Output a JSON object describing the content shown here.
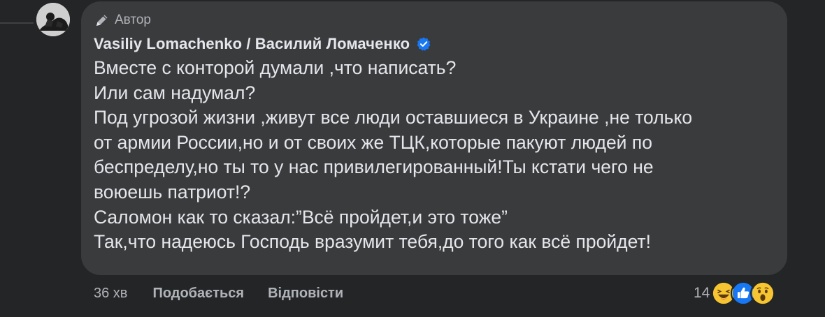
{
  "comment": {
    "author_badge": "Автор",
    "author_name": "Vasiliy Lomachenko / Василий Ломаченко",
    "lines": [
      "Вместе с конторой думали ,что написать?",
      "Или сам надумал?",
      "Под угрозой жизни ,живут все люди оставшиеся в Украине ,не только",
      "от армии России,но и от своих же ТЦК,которые пакуют людей по",
      "беспределу,но ты то у нас привилегированный!Ты кстати чего не",
      "воюешь патриот!?",
      "Саломон как то сказал:”Всё пройдет,и это тоже”",
      "Так,что надеюсь Господь вразумит тебя,до того как всё пройдет!"
    ]
  },
  "actions": {
    "timestamp": "36 хв",
    "like_label": "Подобається",
    "reply_label": "Відповісти"
  },
  "reactions": {
    "count": "14",
    "types": [
      "haha-icon",
      "like-icon",
      "wow-icon"
    ]
  },
  "colors": {
    "page_bg": "#242526",
    "bubble_bg": "#3a3b3c",
    "text_primary": "#e4e6eb",
    "text_secondary": "#b0b3b8",
    "verified_blue": "#1877f2"
  },
  "icons": {
    "author_badge_icon": "pencil-icon",
    "verified_icon": "verified-badge-icon"
  }
}
